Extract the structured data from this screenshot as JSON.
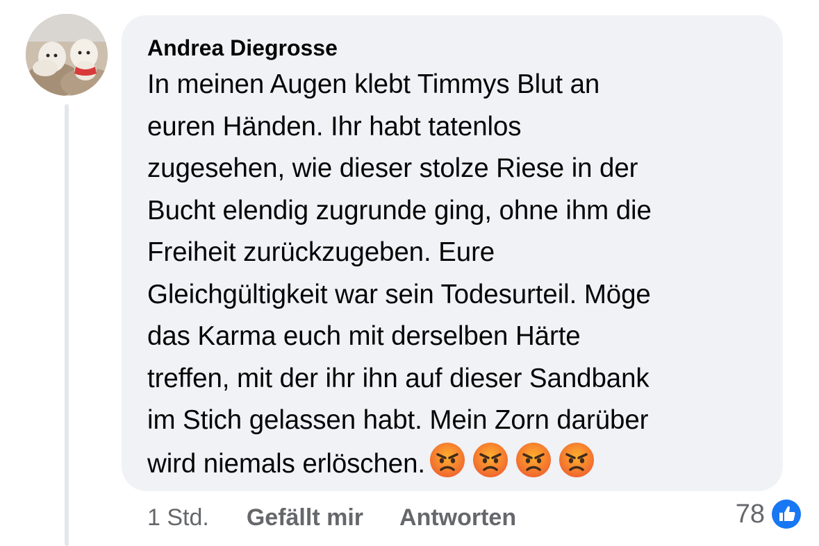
{
  "comment": {
    "author": "Andrea Diegrosse",
    "lines": [
      "In meinen Augen klebt Timmys Blut an",
      "euren Händen. Ihr habt tatenlos",
      "zugesehen, wie dieser stolze Riese in der",
      "Bucht elendig zugrunde ging, ohne ihm die",
      "Freiheit zurückzugeben. Eure",
      "Gleichgültigkeit war sein Todesurteil. Möge",
      "das Karma euch mit derselben Härte",
      "treffen, mit der ihr ihn auf dieser Sandbank",
      "im Stich gelassen habt. Mein Zorn darüber",
      "wird niemals erlöschen."
    ],
    "emojis": [
      "angry-face",
      "angry-face",
      "angry-face",
      "angry-face"
    ],
    "avatar": "profile-photo-two-dogs"
  },
  "actions": {
    "time": "1 Std.",
    "like_label": "Gefällt mir",
    "reply_label": "Antworten"
  },
  "reactions": {
    "count": "78",
    "icon": "like-icon"
  },
  "colors": {
    "bubble": "#f0f2f5",
    "text": "#050505",
    "meta": "#65676b",
    "like_blue": "#1877f2"
  }
}
